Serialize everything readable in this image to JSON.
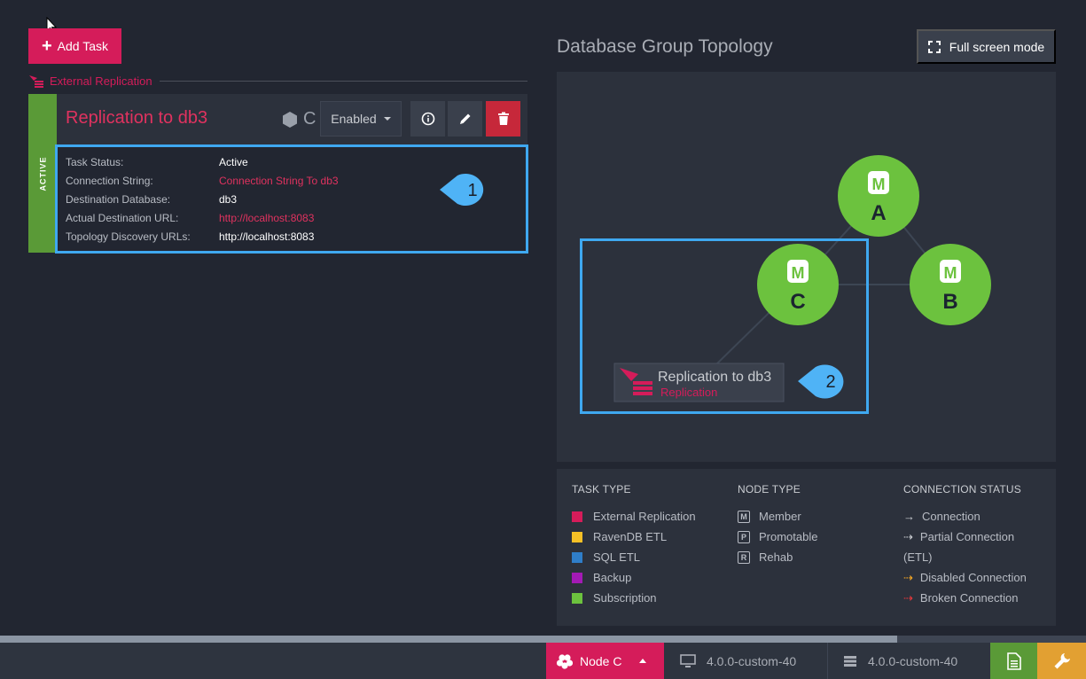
{
  "toolbar": {
    "add_task_label": "Add Task"
  },
  "section": {
    "label": "External Replication"
  },
  "task": {
    "status_bar": "ACTIVE",
    "title": "Replication to db3",
    "node": "C",
    "state_label": "Enabled",
    "details": [
      {
        "key": "Task Status:",
        "value": "Active",
        "link": false
      },
      {
        "key": "Connection String:",
        "value": "Connection String To db3",
        "link": true
      },
      {
        "key": "Destination Database:",
        "value": "db3",
        "link": false
      },
      {
        "key": "Actual Destination URL:",
        "value": "http://localhost:8083",
        "link": true
      },
      {
        "key": "Topology Discovery URLs:",
        "value": "http://localhost:8083",
        "link": false
      }
    ]
  },
  "callouts": {
    "one": "1",
    "two": "2"
  },
  "topology": {
    "title": "Database Group Topology",
    "fullscreen_label": "Full screen mode",
    "nodes": [
      {
        "name": "A",
        "type": "M"
      },
      {
        "name": "B",
        "type": "M"
      },
      {
        "name": "C",
        "type": "M"
      }
    ],
    "task_node": {
      "title": "Replication to db3",
      "subtitle": "Replication"
    }
  },
  "legend": {
    "task_type": {
      "heading": "TASK TYPE",
      "items": [
        {
          "label": "External Replication",
          "color": "#d51c5a"
        },
        {
          "label": "RavenDB ETL",
          "color": "#f5c026"
        },
        {
          "label": "SQL ETL",
          "color": "#2f7ec9"
        },
        {
          "label": "Backup",
          "color": "#a31ab5"
        },
        {
          "label": "Subscription",
          "color": "#6cc23e"
        }
      ]
    },
    "node_type": {
      "heading": "NODE TYPE",
      "items": [
        {
          "label": "Member",
          "icon": "M"
        },
        {
          "label": "Promotable",
          "icon": "P"
        },
        {
          "label": "Rehab",
          "icon": "R"
        }
      ]
    },
    "connection_status": {
      "heading": "CONNECTION STATUS",
      "items": [
        {
          "label": "Connection",
          "color": "#c9ccd1"
        },
        {
          "label": "Partial Connection",
          "color": "#c9ccd1"
        },
        {
          "label": "(ETL)",
          "color": ""
        },
        {
          "label": "Disabled Connection",
          "color": "#f5a623"
        },
        {
          "label": "Broken Connection",
          "color": "#e5383b"
        }
      ]
    }
  },
  "statusbar": {
    "node_label": "Node C",
    "client_version": "4.0.0-custom-40",
    "server_version": "4.0.0-custom-40"
  }
}
